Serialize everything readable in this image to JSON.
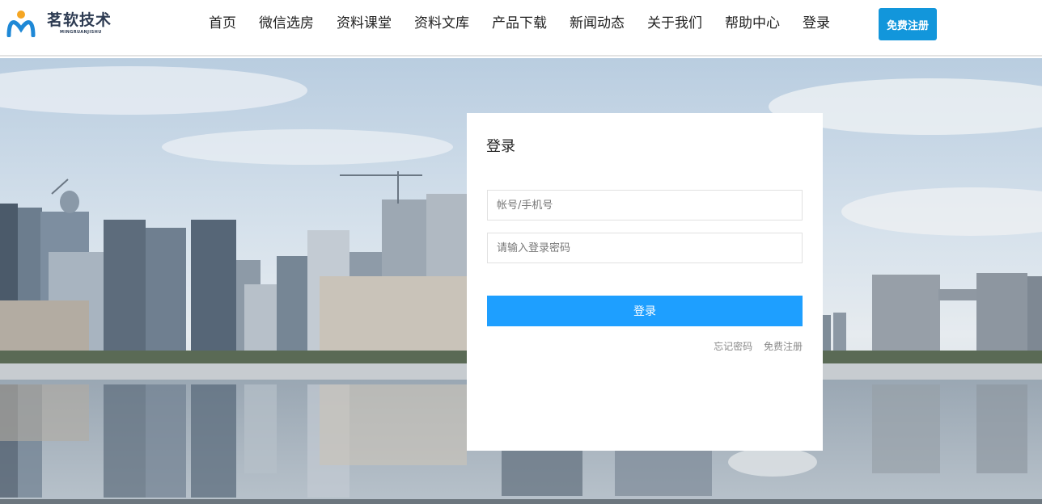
{
  "brand": {
    "name_cn": "茗软技术",
    "name_en": "MINGRUANJISHU",
    "accent_color": "#1296db"
  },
  "nav": {
    "items": [
      "首页",
      "微信选房",
      "资料课堂",
      "资料文库",
      "产品下载",
      "新闻动态",
      "关于我们",
      "帮助中心",
      "登录"
    ],
    "register_label": "免费注册"
  },
  "login": {
    "title": "登录",
    "account_placeholder": "帐号/手机号",
    "password_placeholder": "请输入登录密码",
    "submit_label": "登录",
    "forgot_label": "忘记密码",
    "register_label": "免费注册",
    "button_color": "#1e9fff"
  },
  "background": {
    "icon": "city-skyline-image"
  }
}
